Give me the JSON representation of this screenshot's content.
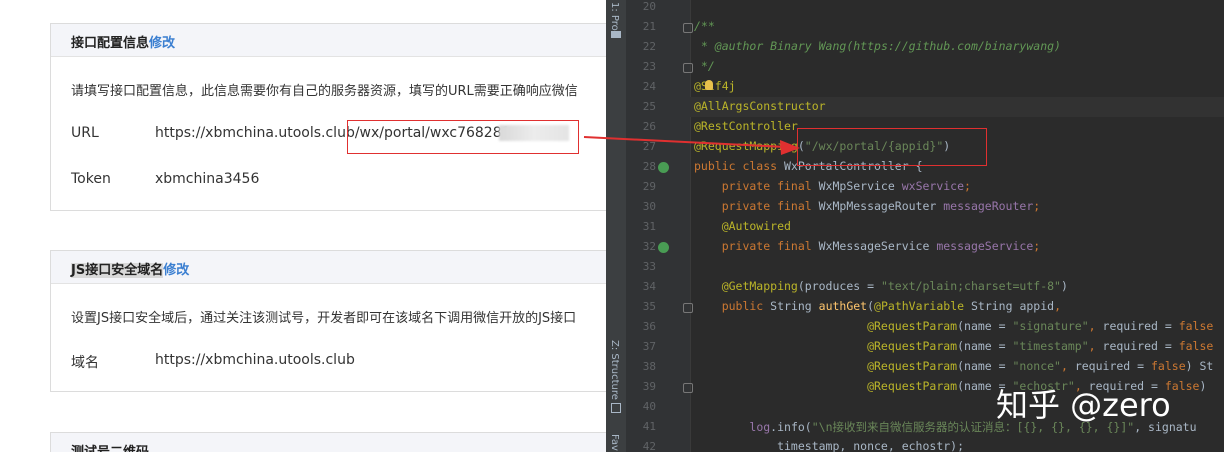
{
  "page": {
    "section1": {
      "title": "接口配置信息",
      "edit": "修改",
      "description": "请填写接口配置信息，此信息需要你有自己的服务器资源，填写的URL需要正确响应微信",
      "url_label": "URL",
      "url_value_prefix": "https://xbmchina.utools.club",
      "url_value_highlighted": "/wx/portal/wxc768281",
      "token_label": "Token",
      "token_value": "xbmchina3456"
    },
    "section2": {
      "title": "JS接口安全域名",
      "edit": "修改",
      "description": "设置JS接口安全域后，通过关注该测试号，开发者即可在该域名下调用微信开放的JS接口",
      "domain_label": "域名",
      "domain_value": "https://xbmchina.utools.club"
    },
    "section3": {
      "title": "测试号二维码"
    }
  },
  "ide": {
    "tool_windows": [
      "1: Pro",
      "Z: Structure",
      "Fav"
    ],
    "line_numbers": [
      "20",
      "21",
      "22",
      "23",
      "24",
      "25",
      "26",
      "27",
      "28",
      "29",
      "30",
      "31",
      "32",
      "33",
      "34",
      "35",
      "36",
      "37",
      "38",
      "39",
      "40",
      "41",
      "42"
    ],
    "lines": [
      [],
      [
        {
          "t": "/**",
          "c": "cmt"
        }
      ],
      [
        {
          "t": " * ",
          "c": "cmt"
        },
        {
          "t": "@author",
          "c": "cmt"
        },
        {
          "t": " Binary Wang(https://github.com/binarywang)",
          "c": "cmt"
        }
      ],
      [
        {
          "t": " */",
          "c": "cmt"
        }
      ],
      [
        {
          "t": "@Slf4j",
          "c": "ann"
        }
      ],
      [
        {
          "t": "@AllArgsConstructor",
          "c": "ann"
        }
      ],
      [
        {
          "t": "@RestController",
          "c": "ann"
        }
      ],
      [
        {
          "t": "@RequestMapping",
          "c": "ann"
        },
        {
          "t": "(",
          "c": ""
        },
        {
          "t": "\"/wx/portal/{appid}\"",
          "c": "str"
        },
        {
          "t": ")",
          "c": ""
        }
      ],
      [
        {
          "t": "public class ",
          "c": "kw"
        },
        {
          "t": "WxPortalController {",
          "c": ""
        }
      ],
      [
        {
          "t": "    private final ",
          "c": "kw"
        },
        {
          "t": "WxMpService ",
          "c": ""
        },
        {
          "t": "wxService",
          "c": "fld"
        },
        {
          "t": ";",
          "c": "kw"
        }
      ],
      [
        {
          "t": "    private final ",
          "c": "kw"
        },
        {
          "t": "WxMpMessageRouter ",
          "c": ""
        },
        {
          "t": "messageRouter",
          "c": "fld"
        },
        {
          "t": ";",
          "c": "kw"
        }
      ],
      [
        {
          "t": "    @Autowired",
          "c": "ann"
        }
      ],
      [
        {
          "t": "    private final ",
          "c": "kw"
        },
        {
          "t": "WxMessageService ",
          "c": ""
        },
        {
          "t": "messageService",
          "c": "fld"
        },
        {
          "t": ";",
          "c": "kw"
        }
      ],
      [],
      [
        {
          "t": "    @GetMapping",
          "c": "ann"
        },
        {
          "t": "(produces = ",
          "c": ""
        },
        {
          "t": "\"text/plain;charset=utf-8\"",
          "c": "str"
        },
        {
          "t": ")",
          "c": ""
        }
      ],
      [
        {
          "t": "    public ",
          "c": "kw"
        },
        {
          "t": "String ",
          "c": ""
        },
        {
          "t": "authGet",
          "c": "mth"
        },
        {
          "t": "(",
          "c": ""
        },
        {
          "t": "@PathVariable ",
          "c": "ann"
        },
        {
          "t": "String appid",
          "c": ""
        },
        {
          "t": ",",
          "c": "kw"
        }
      ],
      [
        {
          "t": "                         @RequestParam",
          "c": "ann"
        },
        {
          "t": "(name = ",
          "c": ""
        },
        {
          "t": "\"signature\"",
          "c": "str"
        },
        {
          "t": ", ",
          "c": "kw"
        },
        {
          "t": "required = ",
          "c": ""
        },
        {
          "t": "false",
          "c": "kw"
        }
      ],
      [
        {
          "t": "                         @RequestParam",
          "c": "ann"
        },
        {
          "t": "(name = ",
          "c": ""
        },
        {
          "t": "\"timestamp\"",
          "c": "str"
        },
        {
          "t": ", ",
          "c": "kw"
        },
        {
          "t": "required = ",
          "c": ""
        },
        {
          "t": "false",
          "c": "kw"
        }
      ],
      [
        {
          "t": "                         @RequestParam",
          "c": "ann"
        },
        {
          "t": "(name = ",
          "c": ""
        },
        {
          "t": "\"nonce\"",
          "c": "str"
        },
        {
          "t": ", ",
          "c": "kw"
        },
        {
          "t": "required = ",
          "c": ""
        },
        {
          "t": "false",
          "c": "kw"
        },
        {
          "t": ") St",
          "c": ""
        }
      ],
      [
        {
          "t": "                         @RequestParam",
          "c": "ann"
        },
        {
          "t": "(name = ",
          "c": ""
        },
        {
          "t": "\"echostr\"",
          "c": "str"
        },
        {
          "t": ", ",
          "c": "kw"
        },
        {
          "t": "required = ",
          "c": ""
        },
        {
          "t": "false",
          "c": "kw"
        },
        {
          "t": ") ",
          "c": ""
        }
      ],
      [],
      [
        {
          "t": "        ",
          "c": ""
        },
        {
          "t": "log",
          "c": "fld"
        },
        {
          "t": ".info(",
          "c": ""
        },
        {
          "t": "\"\\n接收到来自微信服务器的认证消息：[{}, {}, {}, {}]\"",
          "c": "str"
        },
        {
          "t": ", signatu",
          "c": ""
        }
      ],
      [
        {
          "t": "            timestamp, nonce, echostr);",
          "c": ""
        }
      ]
    ]
  },
  "watermark": "知乎 @zero",
  "colors": {
    "highlight_box": "#e03030",
    "link": "#3b7fd1",
    "ide_background": "#2b2b2b"
  }
}
